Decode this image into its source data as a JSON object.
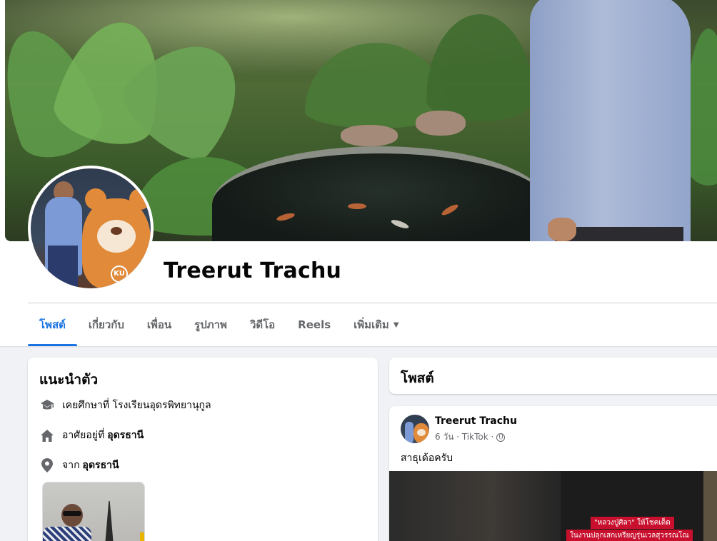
{
  "profile": {
    "name": "Treerut Trachu"
  },
  "tabs": [
    {
      "label": "โพสต์",
      "active": true
    },
    {
      "label": "เกี่ยวกับ",
      "active": false
    },
    {
      "label": "เพื่อน",
      "active": false
    },
    {
      "label": "รูปภาพ",
      "active": false
    },
    {
      "label": "วิดีโอ",
      "active": false
    },
    {
      "label": "Reels",
      "active": false
    },
    {
      "label": "เพิ่มเติม",
      "active": false
    }
  ],
  "intro": {
    "title": "แนะนำตัว",
    "education_prefix": "เคยศึกษาที่ โรงเรียนอุดรพิทยานุกูล",
    "lives_prefix": "อาศัยอยู่ที่",
    "lives_place": "อุดรธานี",
    "from_prefix": "จาก",
    "from_place": "อุดรธานี"
  },
  "posts": {
    "title": "โพสต์",
    "items": [
      {
        "author": "Treerut Trachu",
        "meta": "6 วัน · TikTok ·",
        "text": "สาธุเด้อครับ",
        "media_caption_1": "\"หลวงปู่ศิลา\" ให้โชคเด็ด",
        "media_caption_2": "ในงานปลุกเสกเหรียญรุ่นเวลสุวรรณโณ"
      }
    ]
  },
  "colors": {
    "accent": "#1b74e4",
    "page_bg": "#f0f2f5",
    "muted_text": "#65676b"
  },
  "icons": {
    "education": "graduation-cap-icon",
    "home": "home-icon",
    "location": "location-pin-icon",
    "privacy": "globe-icon",
    "more": "caret-down-icon"
  }
}
